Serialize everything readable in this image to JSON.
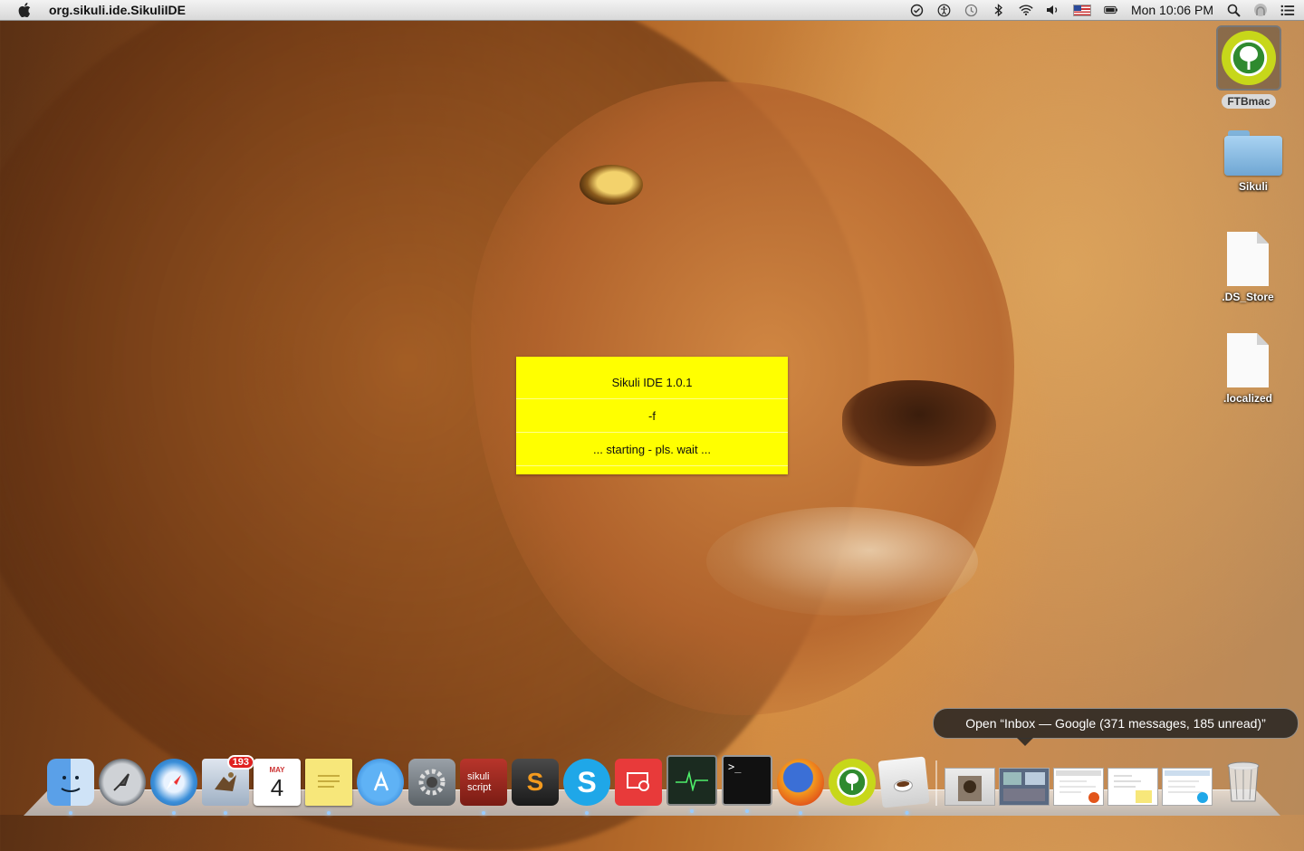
{
  "menubar": {
    "app_name": "org.sikuli.ide.SikuliIDE",
    "clock": "Mon 10:06 PM"
  },
  "desktop": {
    "icons": [
      {
        "label": "FTBmac"
      },
      {
        "label": "Sikuli"
      },
      {
        "label": ".DS_Store"
      },
      {
        "label": ".localized"
      }
    ]
  },
  "splash": {
    "line1": "Sikuli IDE 1.0.1",
    "line2": "-f",
    "line3": "... starting - pls. wait ..."
  },
  "tooltip": {
    "text": "Open “Inbox — Google (371 messages, 185 unread)”"
  },
  "dock": {
    "mail_badge": "193",
    "calendar_month": "MAY",
    "calendar_day": "4",
    "sikuli_script_label": "sikuli script"
  },
  "colors": {
    "splash_bg": "#ffff00",
    "menubar_bg": "#e6e6e6"
  }
}
